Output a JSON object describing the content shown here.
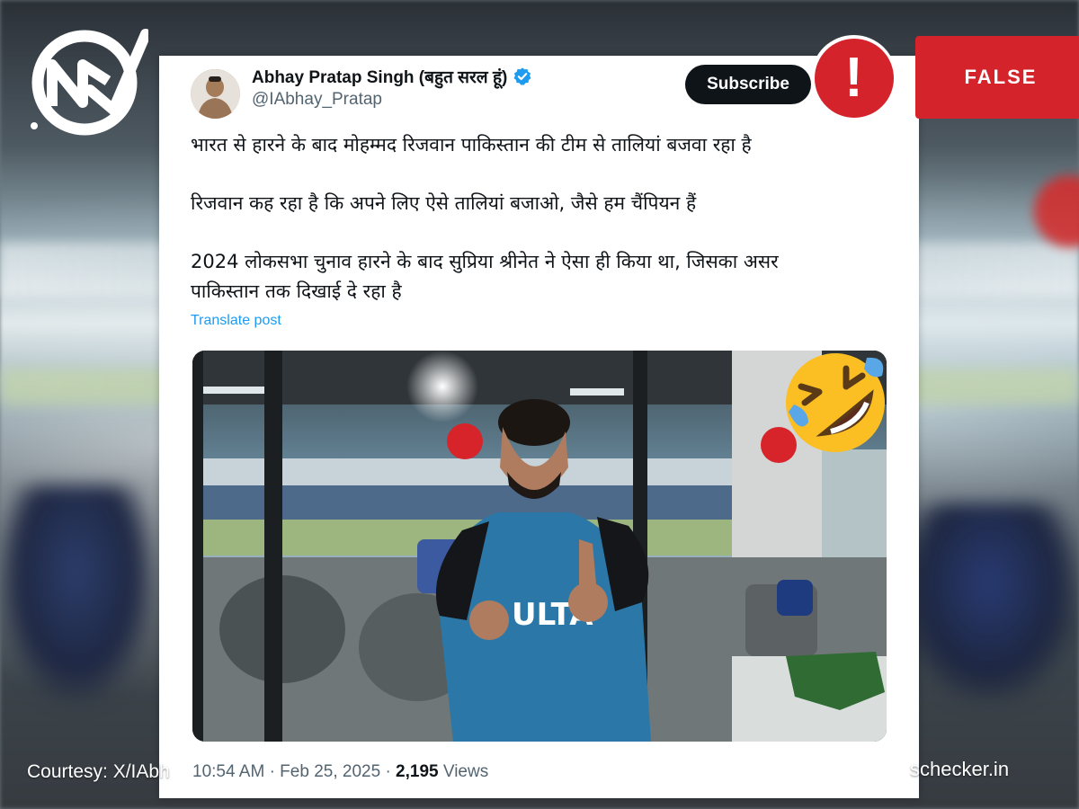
{
  "badge": {
    "verdict": "FALSE",
    "alert_symbol": "!"
  },
  "tweet": {
    "author_name": "Abhay Pratap Singh (बहुत सरल हूं)",
    "handle": "@IAbhay_Pratap",
    "subscribe_label": "Subscribe",
    "text_lines": [
      "भारत से हारने के बाद मोहम्मद रिजवान पाकिस्तान की टीम से तालियां बजवा रहा है",
      "रिजवान कह रहा है कि अपने लिए ऐसे तालियां बजाओ, जैसे हम चैंपियन हैं",
      "2024 लोकसभा चुनाव हारने के बाद सुप्रिया श्रीनेत ने ऐसा ही किया था, जिसका असर",
      "पाकिस्तान तक दिखाई दे रहा है"
    ],
    "translate_label": "Translate post",
    "time": "10:54 AM",
    "date": "Feb 25, 2025",
    "views_count": "2,195",
    "views_label": "Views",
    "jersey_text": "ULTA"
  },
  "footer": {
    "courtesy": "Courtesy: X/IAbh",
    "domain": "schecker.in"
  },
  "colors": {
    "false_red": "#d4232b",
    "link_blue": "#1d9bf0",
    "verified_blue": "#1d9bf0"
  },
  "icons": [
    "newschecker-logo-icon",
    "alert-icon",
    "verified-icon",
    "laughing-emoji-icon"
  ]
}
